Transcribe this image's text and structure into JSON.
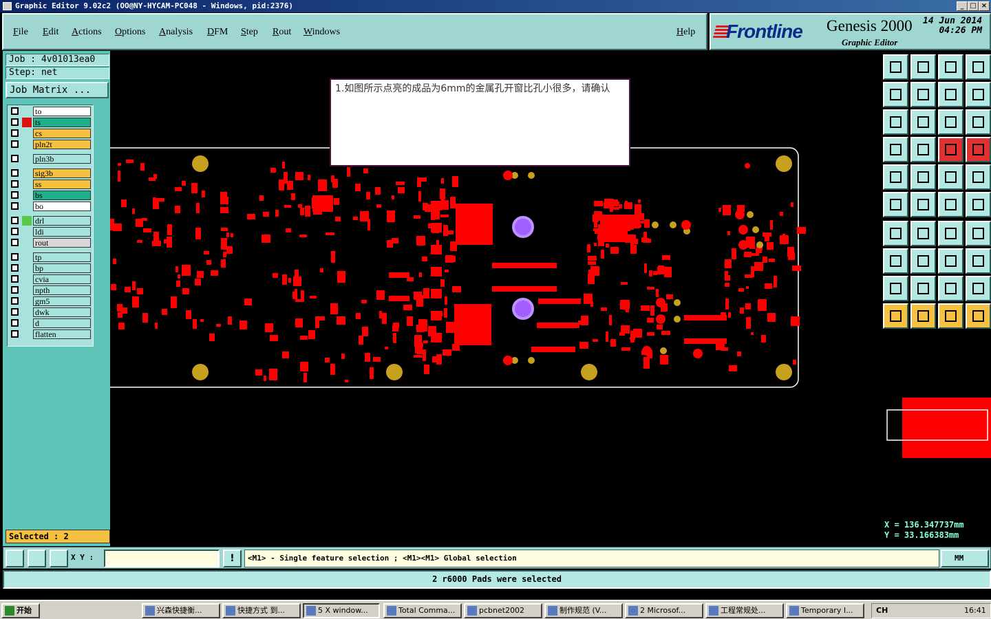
{
  "window": {
    "title": "Graphic Editor 9.02c2 (OO@NY-HYCAM-PC048 - Windows, pid:2376)"
  },
  "menu": [
    "File",
    "Edit",
    "Actions",
    "Options",
    "Analysis",
    "DFM",
    "Step",
    "Rout",
    "Windows"
  ],
  "help": "Help",
  "brand": {
    "logo": "Frontline",
    "product": "Genesis 2000",
    "subtitle": "Graphic Editor",
    "date": "14 Jun 2014",
    "time": "04:26 PM"
  },
  "job": {
    "job": "Job : 4v01013ea0",
    "step": "Step: net",
    "matrix": "Job Matrix ..."
  },
  "layers": [
    {
      "name": "to",
      "color": "#ffffff",
      "mark": ""
    },
    {
      "name": "ts",
      "color": "#1fb08a",
      "mark": "#e01010"
    },
    {
      "name": "cs",
      "color": "#f6c040",
      "mark": ""
    },
    {
      "name": "pln2t",
      "color": "#f6c040",
      "mark": ""
    },
    {
      "name": "pln3b",
      "color": "#a8e2dc",
      "mark": ""
    },
    {
      "name": "sig3b",
      "color": "#f6c040",
      "mark": ""
    },
    {
      "name": "ss",
      "color": "#f6c040",
      "mark": ""
    },
    {
      "name": "bs",
      "color": "#1fb08a",
      "mark": ""
    },
    {
      "name": "bo",
      "color": "#ffffff",
      "mark": ""
    },
    {
      "name": "drl",
      "color": "#a8e2dc",
      "mark": "#58c848"
    },
    {
      "name": "ldi",
      "color": "#a8e2dc",
      "mark": ""
    },
    {
      "name": "rout",
      "color": "#d8d8d8",
      "mark": ""
    },
    {
      "name": "tp",
      "color": "#a8e2dc",
      "mark": ""
    },
    {
      "name": "bp",
      "color": "#a8e2dc",
      "mark": ""
    },
    {
      "name": "cvia",
      "color": "#a8e2dc",
      "mark": ""
    },
    {
      "name": "npth",
      "color": "#a8e2dc",
      "mark": ""
    },
    {
      "name": "gm5",
      "color": "#a8e2dc",
      "mark": ""
    },
    {
      "name": "dwk",
      "color": "#a8e2dc",
      "mark": ""
    },
    {
      "name": "d",
      "color": "#a8e2dc",
      "mark": ""
    },
    {
      "name": "flatten",
      "color": "#a8e2dc",
      "mark": ""
    }
  ],
  "selected": "Selected : 2",
  "note": "1.如图所示点亮的成品为6mm的金属孔开窗比孔小很多，请确认",
  "coords": {
    "x": "X = 136.347737mm",
    "y": "Y = 33.166383mm"
  },
  "xy_label": "X Y :",
  "hint": "<M1> - Single feature selection ; <M1><M1> Global selection",
  "units": "MM",
  "status": "2 r6000 Pads were selected",
  "taskbar": {
    "start": "开始",
    "tasks": [
      "兴森快捷衡...",
      "快捷方式 到...",
      "5 X window...",
      "Total Comma...",
      "pcbnet2002",
      "制作规范 (V...",
      "2 Microsof...",
      "工程常规处...",
      "Temporary I..."
    ],
    "lang": "CH",
    "clock": "16:41"
  },
  "colors": {
    "pad": "#ff0000",
    "hole": "#c8a020",
    "via": "#a060ff",
    "panel": "#5fc5ba"
  }
}
